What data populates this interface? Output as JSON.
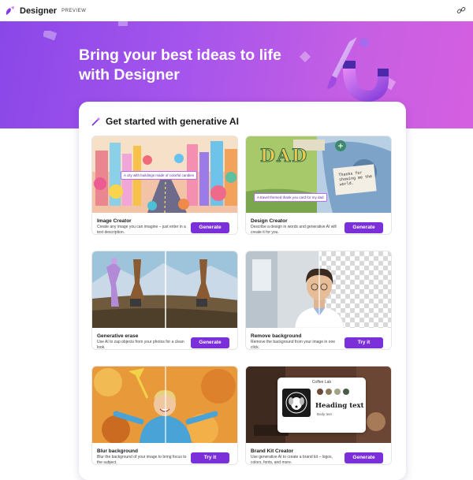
{
  "app": {
    "name": "Designer",
    "badge": "PREVIEW"
  },
  "hero": {
    "title": "Bring your best ideas to life with Designer"
  },
  "section": {
    "title": "Get started with generative AI"
  },
  "tiles": [
    {
      "name": "Image Creator",
      "description": "Create any image you can imagine – just enter in a text description.",
      "button": "Generate",
      "callout": "A city with buildings made of colorful candies"
    },
    {
      "name": "Design Creator",
      "description": "Describe a design in words and generative AI will create it for you.",
      "button": "Generate",
      "callout": "A travel themed thank you card for my dad",
      "card_word": "DAD",
      "card_note": "Thanks for showing me the world."
    },
    {
      "name": "Generative erase",
      "description": "Use AI to zap objects from your photos for a clean look.",
      "button": "Generate"
    },
    {
      "name": "Remove background",
      "description": "Remove the background from your image in one click.",
      "button": "Try it"
    },
    {
      "name": "Blur background",
      "description": "Blur the background of your image to bring focus to the subject.",
      "button": "Try it"
    },
    {
      "name": "Brand Kit Creator",
      "description": "Use generative AI to create a brand kit – logos, colors, fonts, and more.",
      "button": "Generate",
      "brand_name": "Coffee Lab",
      "heading_sample": "Heading text",
      "body_sample": "Body text"
    }
  ],
  "colors": {
    "accent": "#7a2fd8",
    "hero_start": "#8a47e8",
    "hero_end": "#d55fe0"
  },
  "icons": {
    "logo": "designer-logo-icon",
    "link": "link-icon",
    "wand": "magic-wand-icon"
  }
}
